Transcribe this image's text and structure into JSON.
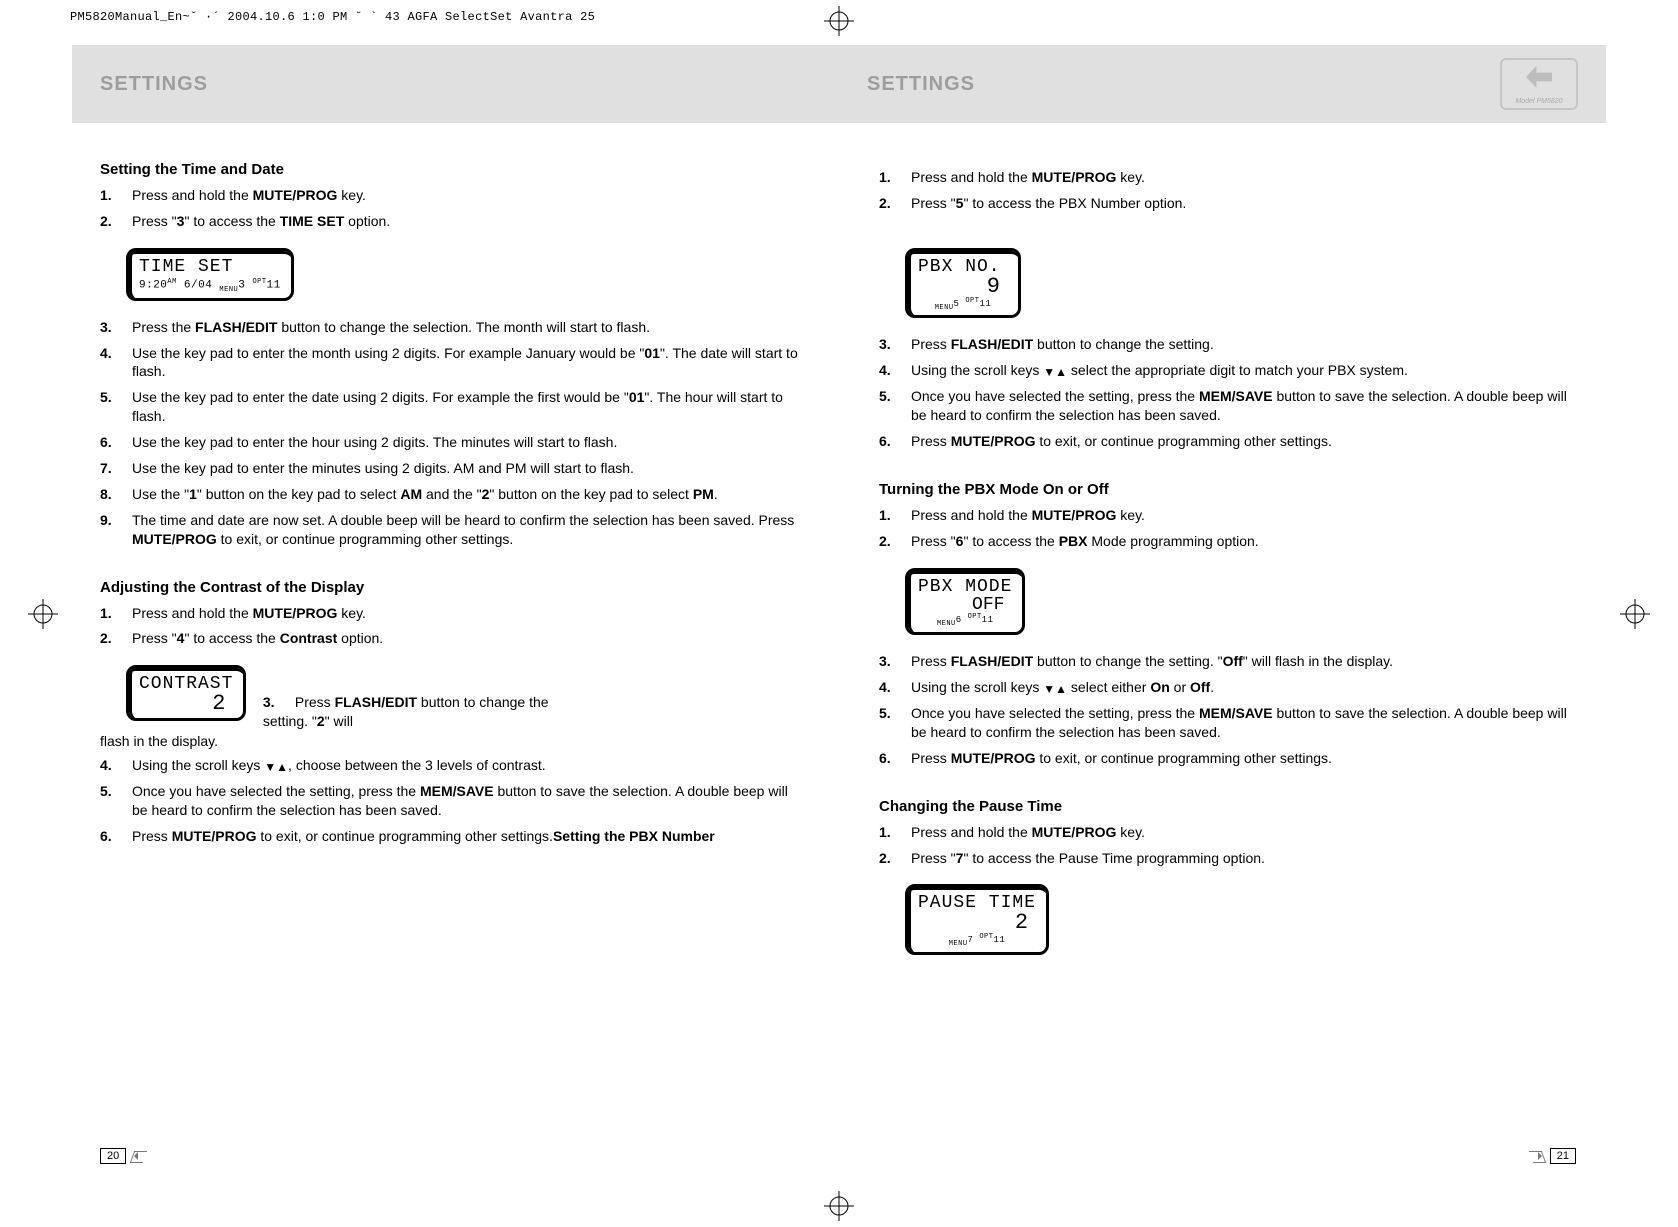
{
  "print_header": "PM5820Manual_En~ˇ ·´  2004.10.6 1:0 PM  ˘  ` 43   AGFA SelectSet Avantra 25",
  "left": {
    "title": "SETTINGS",
    "section1": {
      "heading": "Setting the Time and Date",
      "items": [
        {
          "n": "1.",
          "html": "Press and hold the <b>MUTE/PROG</b> key."
        },
        {
          "n": "2.",
          "html": "Press \"<b>3</b>\" to access the <b>TIME SET</b> option."
        }
      ],
      "lcd": {
        "line1": "TIME SET",
        "line2_html": "9:20<span class='super'>AM</span> 6/04 <span class='sub'>MENU</span>3  <span class='super'>OPT</span>11"
      },
      "items2": [
        {
          "n": "3.",
          "html": "Press the <b>FLASH/EDIT</b> button to change the selection. The month will start to flash."
        },
        {
          "n": "4.",
          "html": "Use the key pad to enter the month using 2 digits. For example January would be \"<b>01</b>\". The date will start to flash."
        },
        {
          "n": "5.",
          "html": "Use the key pad to enter the date using 2 digits. For example the first would be \"<b>01</b>\". The hour will start to flash."
        },
        {
          "n": "6.",
          "html": "Use the key pad to enter the hour using 2 digits.  The minutes will start to flash."
        },
        {
          "n": "7.",
          "html": "Use the key pad to enter the minutes using 2 digits. AM and PM will start to flash."
        },
        {
          "n": "8.",
          "html": "Use the \"<b>1</b>\" button on the key pad to select <b>AM</b> and the \"<b>2</b>\" button on the key pad to select <b>PM</b>."
        },
        {
          "n": "9.",
          "html": "The time and date are now set. A double beep will be heard to confirm the selection has been saved. Press <b>MUTE/PROG</b> to exit, or continue programming other settings."
        }
      ]
    },
    "section2": {
      "heading": "Adjusting the Contrast of the Display",
      "items": [
        {
          "n": "1.",
          "html": "Press and hold the <b>MUTE/PROG</b> key."
        },
        {
          "n": "2.",
          "html": "Press \"<b>4</b>\" to access the <b>Contrast</b> option."
        }
      ],
      "lcd": {
        "line1": "CONTRAST",
        "big": "2"
      },
      "step3_num": "3.",
      "step3_html": "Press <b>FLASH/EDIT</b> button to change the setting. \"<b>2</b>\" will",
      "flash_note": "flash in the display.",
      "items2": [
        {
          "n": "4.",
          "html": "Using the scroll keys <span class='arrows'>▼▲</span>, choose between the 3 levels of contrast."
        },
        {
          "n": "5.",
          "html": "Once you have selected the setting, press the <b>MEM/SAVE</b> button to save the selection. A double beep will be heard to confirm the selection has been saved."
        }
      ],
      "step6_num": "6.",
      "step6_html": "Press <b>MUTE/PROG</b> to exit, or continue programming other settings.",
      "trailing_heading": "Setting the PBX Number"
    },
    "page_number": "20"
  },
  "right": {
    "title": "SETTINGS",
    "model": "Model PM5820",
    "sectionA": {
      "items": [
        {
          "n": "1.",
          "html": "Press and hold the <b>MUTE/PROG</b> key."
        },
        {
          "n": "2.",
          "html": "Press \"<b>5</b>\" to access the PBX Number option."
        }
      ],
      "lcd": {
        "line1": "PBX NO.",
        "big": "9",
        "line3_html": "<span class='sub'>MENU</span>5  <span class='super'>OPT</span>11"
      },
      "items2": [
        {
          "n": "3.",
          "html": "Press <b>FLASH/EDIT</b> button to change the setting."
        },
        {
          "n": "4.",
          "html": "Using the scroll keys <span class='arrows'>▼▲</span> select the appropriate digit to match your PBX system."
        },
        {
          "n": "5.",
          "html": "Once you have selected the setting, press the <b>MEM/SAVE</b> button to save the selection. A double beep will be heard to confirm the selection has been saved."
        },
        {
          "n": "6.",
          "html": "Press <b>MUTE/PROG</b> to exit, or continue programming other settings."
        }
      ]
    },
    "sectionB": {
      "heading": "Turning the PBX Mode On or Off",
      "items": [
        {
          "n": "1.",
          "html": "Press and hold the <b>MUTE/PROG</b> key."
        },
        {
          "n": "2.",
          "html": "Press \"<b>6</b>\" to access the <b>PBX</b> Mode programming option."
        }
      ],
      "lcd": {
        "line1": "PBX MODE",
        "big": "OFF",
        "line3_html": "<span class='sub'>MENU</span>6  <span class='super'>OPT</span>11"
      },
      "items2": [
        {
          "n": "3.",
          "html": "Press <b>FLASH/EDIT</b> button to change the setting. \"<b>Off</b>\" will flash in the display."
        },
        {
          "n": "4.",
          "html": "Using the scroll keys <span class='arrows'>▼▲</span> select either <b>On</b> or <b>Off</b>."
        },
        {
          "n": "5.",
          "html": "Once you have selected the setting, press the <b>MEM/SAVE</b> button to save the selection. A double beep will be heard to confirm the selection has been saved."
        },
        {
          "n": "6.",
          "html": "Press <b>MUTE/PROG</b> to exit, or continue programming other settings."
        }
      ]
    },
    "sectionC": {
      "heading": "Changing the Pause Time",
      "items": [
        {
          "n": "1.",
          "html": "Press and hold the <b>MUTE/PROG</b> key."
        },
        {
          "n": "2.",
          "html": "Press \"<b>7</b>\" to access the Pause Time programming option."
        }
      ],
      "lcd": {
        "line1": "PAUSE TIME",
        "big": "2",
        "line3_html": "<span class='sub'>MENU</span>7  <span class='super'>OPT</span>11"
      }
    },
    "page_number": "21"
  }
}
